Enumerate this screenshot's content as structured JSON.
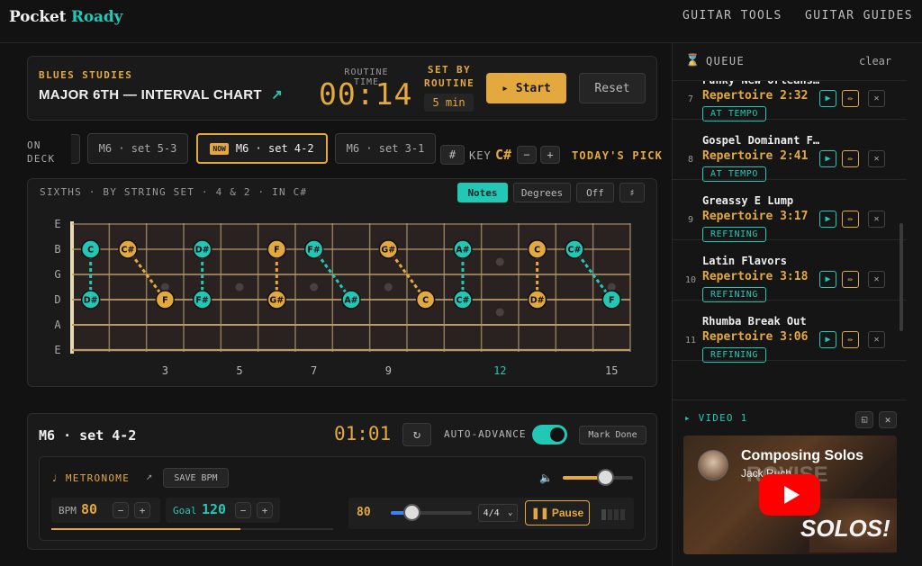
{
  "brand": {
    "part1": "Pocket",
    "part2": "Roady"
  },
  "nav": {
    "tools": "GUITAR TOOLS",
    "guides": "GUITAR GUIDES"
  },
  "routine": {
    "category": "BLUES STUDIES",
    "title": "MAJOR 6TH — INTERVAL CHART",
    "time_label": "ROUTINE TIME",
    "time_value": "00:14",
    "set_by_line1": "SET BY",
    "set_by_line2": "ROUTINE",
    "set_by_value": "5 min",
    "start_label": "▸ Start",
    "reset_label": "Reset"
  },
  "deck": {
    "label_line1": "ON",
    "label_line2": "DECK",
    "chips": [
      "M6 · set 5-3",
      "M6 · set 4-2",
      "M6 · set 3-1"
    ],
    "now_badge": "NOW",
    "sharp_label": "#",
    "key_label": "KEY",
    "key_value": "C#",
    "minus": "−",
    "plus": "+",
    "todays_pick": "TODAY'S PICK"
  },
  "fretboard": {
    "heading": "SIXTHS · BY STRING SET · 4 & 2 · IN C#",
    "modes": [
      "Notes",
      "Degrees",
      "Off",
      "♯"
    ],
    "strings": [
      "E",
      "B",
      "G",
      "D",
      "A",
      "E"
    ],
    "fret_numbers": [
      "3",
      "5",
      "7",
      "9",
      "12",
      "15"
    ],
    "notes": [
      {
        "fret": 1,
        "string": 1,
        "label": "C",
        "color": "teal"
      },
      {
        "fret": 1,
        "string": 3,
        "label": "D#",
        "color": "teal"
      },
      {
        "fret": 2,
        "string": 1,
        "label": "C#",
        "color": "gold"
      },
      {
        "fret": 3,
        "string": 3,
        "label": "F",
        "color": "gold"
      },
      {
        "fret": 4,
        "string": 1,
        "label": "D#",
        "color": "teal"
      },
      {
        "fret": 4,
        "string": 3,
        "label": "F#",
        "color": "teal"
      },
      {
        "fret": 6,
        "string": 1,
        "label": "F",
        "color": "gold"
      },
      {
        "fret": 6,
        "string": 3,
        "label": "G#",
        "color": "gold"
      },
      {
        "fret": 7,
        "string": 1,
        "label": "F#",
        "color": "teal"
      },
      {
        "fret": 8,
        "string": 3,
        "label": "A#",
        "color": "teal"
      },
      {
        "fret": 9,
        "string": 1,
        "label": "G#",
        "color": "gold"
      },
      {
        "fret": 10,
        "string": 3,
        "label": "C",
        "color": "gold"
      },
      {
        "fret": 11,
        "string": 1,
        "label": "A#",
        "color": "teal"
      },
      {
        "fret": 11,
        "string": 3,
        "label": "C#",
        "color": "teal"
      },
      {
        "fret": 13,
        "string": 1,
        "label": "C",
        "color": "gold"
      },
      {
        "fret": 13,
        "string": 3,
        "label": "D#",
        "color": "gold"
      },
      {
        "fret": 14,
        "string": 1,
        "label": "C#",
        "color": "teal"
      },
      {
        "fret": 15,
        "string": 3,
        "label": "F",
        "color": "teal"
      }
    ],
    "links": [
      [
        0,
        1
      ],
      [
        2,
        3
      ],
      [
        4,
        5
      ],
      [
        6,
        7
      ],
      [
        8,
        9
      ],
      [
        10,
        11
      ],
      [
        12,
        13
      ],
      [
        14,
        15
      ],
      [
        16,
        17
      ]
    ]
  },
  "practice": {
    "title": "M6 · set 4-2",
    "timer": "01:01",
    "auto_advance_label": "AUTO-ADVANCE",
    "auto_advance_on": true,
    "mark_done_label": "Mark Done",
    "metronome_label": "♩ METRONOME",
    "save_bpm_label": "SAVE BPM",
    "bpm_label": "BPM",
    "bpm_value": "80",
    "goal_label": "Goal",
    "goal_value": "120",
    "tempo_value": "80",
    "tempo_fraction": 0.25,
    "volume_fraction": 0.6,
    "bpm_progress_fraction": 0.67,
    "time_sig": "4/4",
    "pause_label": "Pause"
  },
  "queue": {
    "title": "QUEUE",
    "clear_label": "clear",
    "items": [
      {
        "num": "7",
        "name": "Funky New Orleans…",
        "meta": "Repertoire 2:32",
        "status": "AT TEMPO"
      },
      {
        "num": "8",
        "name": "Gospel Dominant F…",
        "meta": "Repertoire 2:41",
        "status": "AT TEMPO"
      },
      {
        "num": "9",
        "name": "Greassy E Lump",
        "meta": "Repertoire 3:17",
        "status": "REFINING"
      },
      {
        "num": "10",
        "name": "Latin Flavors",
        "meta": "Repertoire 3:18",
        "status": "REFINING"
      },
      {
        "num": "11",
        "name": "Rhumba Break Out",
        "meta": "Repertoire 3:06",
        "status": "REFINING"
      }
    ]
  },
  "video": {
    "label": "▸ VIDEO 1",
    "title": "Composing Solos",
    "author": "Jack Ruch",
    "overlay_text": "SOLOS!"
  },
  "colors": {
    "gold": "#e3a93f",
    "teal": "#22c7b5",
    "bg": "#121212",
    "panel": "#1a1a1a"
  }
}
